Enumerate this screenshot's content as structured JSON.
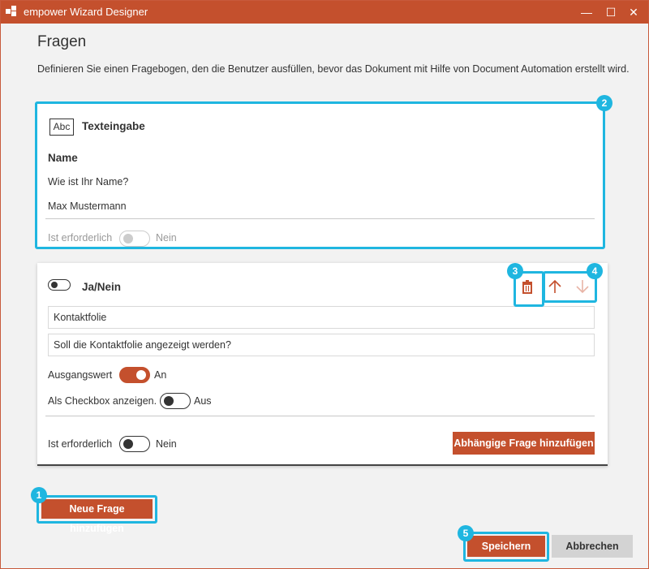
{
  "window": {
    "title": "empower Wizard Designer",
    "minimize_glyph": "—",
    "maximize_glyph": "☐",
    "close_glyph": "✕"
  },
  "page": {
    "heading": "Fragen",
    "description": "Definieren Sie einen Fragebogen, den die Benutzer ausfüllen, bevor das Dokument mit Hilfe von Document Automation erstellt wird."
  },
  "question1": {
    "type_icon_text": "Abc",
    "type_label": "Texteingabe",
    "name_label": "Name",
    "question_text": "Wie ist Ihr Name?",
    "default_value": "Max Mustermann",
    "required_label": "Ist erforderlich",
    "required_state": "Nein"
  },
  "question2": {
    "type_label": "Ja/Nein",
    "name_value": "Kontaktfolie",
    "question_value": "Soll die Kontaktfolie angezeigt werden?",
    "default_label": "Ausgangswert",
    "default_state": "An",
    "checkbox_label": "Als Checkbox anzeigen.",
    "checkbox_state": "Aus",
    "required_label": "Ist erforderlich",
    "required_state": "Nein",
    "add_dependent_label": "Abhängige Frage hinzufügen"
  },
  "buttons": {
    "add_question": "Neue Frage hinzufügen",
    "save": "Speichern",
    "cancel": "Abbrechen"
  },
  "callouts": [
    "1",
    "2",
    "3",
    "4",
    "5"
  ],
  "colors": {
    "accent": "#c4502d",
    "highlight": "#1fb6e0"
  },
  "icons": [
    "app-logo-icon",
    "abc-text-icon",
    "toggle-icon",
    "trash-icon",
    "arrow-up-icon",
    "arrow-down-icon"
  ]
}
